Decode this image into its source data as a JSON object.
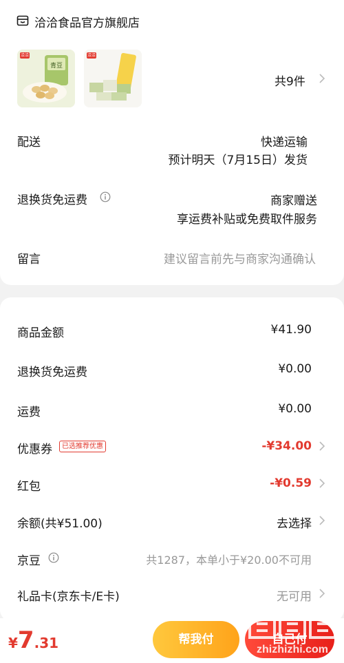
{
  "store": {
    "name": "洽洽食品官方旗舰店",
    "item_count": "共9件"
  },
  "delivery": {
    "label": "配送",
    "method": "快递运输",
    "eta": "预计明天（7月15日）发货"
  },
  "return_shipping": {
    "label": "退换货免运费",
    "value": "商家赠送",
    "desc": "享运费补贴或免费取件服务"
  },
  "message": {
    "label": "留言",
    "placeholder": "建议留言前先与商家沟通确认"
  },
  "summary": {
    "goods_amount": {
      "label": "商品金额",
      "value": "¥41.90"
    },
    "return_fee": {
      "label": "退换货免运费",
      "value": "¥0.00"
    },
    "shipping": {
      "label": "运费",
      "value": "¥0.00"
    },
    "coupon": {
      "label": "优惠券",
      "tag": "已选推荐优惠",
      "value": "-¥34.00"
    },
    "red_packet": {
      "label": "红包",
      "value": "-¥0.59"
    },
    "balance": {
      "label": "余额(共¥51.00)",
      "value": "去选择"
    },
    "jingdou": {
      "label": "京豆",
      "value": "共1287，本单小于¥20.00不可用"
    },
    "gift_card": {
      "label": "礼品卡(京东卡/E卡)",
      "value": "无可用"
    }
  },
  "footer": {
    "currency": "¥",
    "price_int": "7",
    "price_dec": ".31",
    "help_pay": "帮我付",
    "self_pay": "自己付"
  },
  "thumb1": {
    "brand": "洽洽",
    "title": "青豆"
  },
  "thumb2": {
    "brand": "洽洽"
  },
  "watermark": "值 什么值得买 zhizhizhi.com",
  "colors": {
    "accent_red": "#e23a2f",
    "button_yellow": "#ffb52e",
    "button_red": "#e8201a"
  }
}
